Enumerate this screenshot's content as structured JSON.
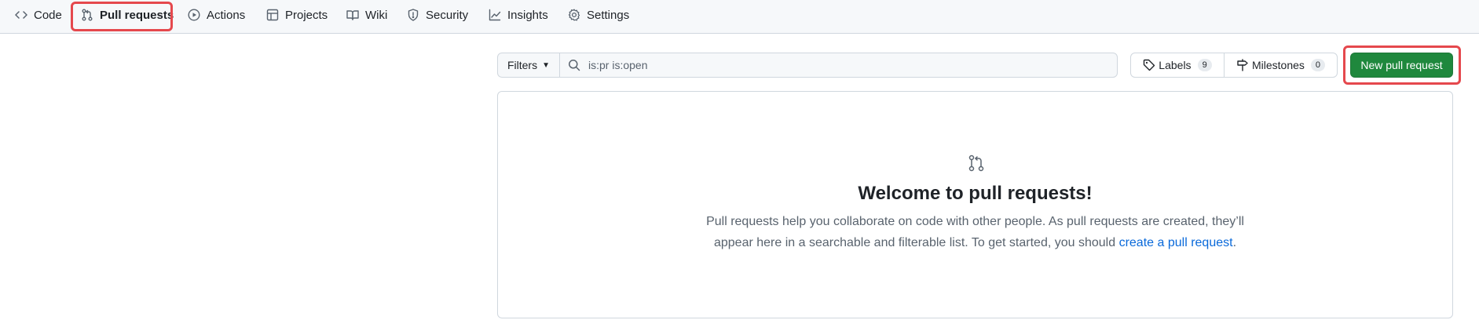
{
  "repo_nav": {
    "tabs": [
      {
        "label": "Code",
        "icon": "code-icon"
      },
      {
        "label": "Pull requests",
        "icon": "git-pull-request-icon",
        "active": true
      },
      {
        "label": "Actions",
        "icon": "play-icon"
      },
      {
        "label": "Projects",
        "icon": "table-icon"
      },
      {
        "label": "Wiki",
        "icon": "book-icon"
      },
      {
        "label": "Security",
        "icon": "shield-icon"
      },
      {
        "label": "Insights",
        "icon": "graph-icon"
      },
      {
        "label": "Settings",
        "icon": "gear-icon"
      }
    ]
  },
  "filters": {
    "button_label": "Filters",
    "search_value": "is:pr is:open"
  },
  "labels": {
    "label": "Labels",
    "count": "9"
  },
  "milestones": {
    "label": "Milestones",
    "count": "0"
  },
  "new_pr_label": "New pull request",
  "blankslate": {
    "title": "Welcome to pull requests!",
    "description_before": "Pull requests help you collaborate on code with other people. As pull requests are created, they’ll appear here in a searchable and filterable list. To get started, you should ",
    "link_text": "create a pull request",
    "description_after": "."
  },
  "colors": {
    "accent_green": "#1f883d",
    "highlight_red": "#e5484d",
    "link_blue": "#0969da"
  }
}
